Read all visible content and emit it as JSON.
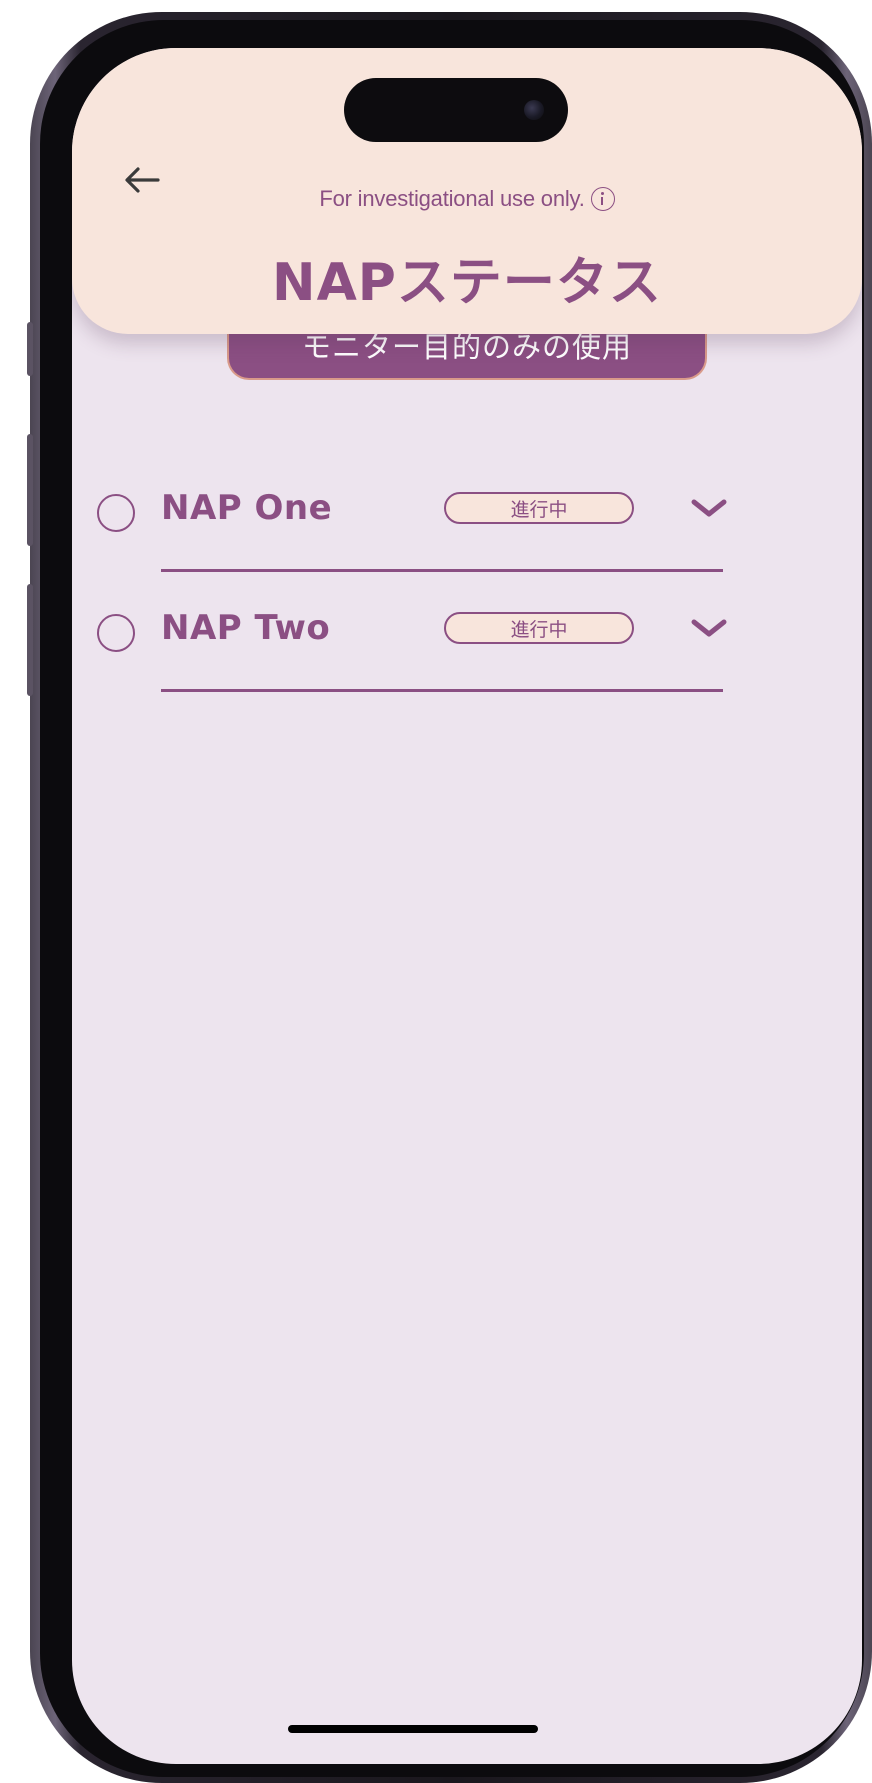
{
  "header": {
    "disclaimer": "For investigational use only.",
    "title": "NAPステータス"
  },
  "banner": {
    "label": "モニター目的のみの使用"
  },
  "naps": [
    {
      "name": "NAP One",
      "status": "進行中"
    },
    {
      "name": "NAP Two",
      "status": "進行中"
    }
  ],
  "icons": {
    "back": "arrow-left-icon",
    "info": "info-circle-icon",
    "expand": "chevron-down-icon"
  },
  "colors": {
    "accent": "#8b4f83",
    "header_bg": "#f8e5dc",
    "screen_bg": "#ede4ee",
    "pill_border": "#d99a8a"
  }
}
